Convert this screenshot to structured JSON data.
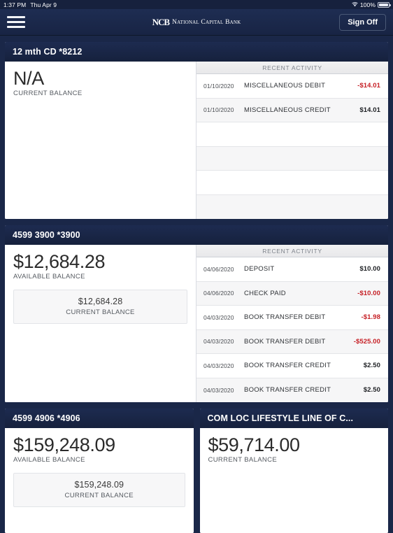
{
  "status_bar": {
    "time": "1:37 PM",
    "date": "Thu Apr 9",
    "wifi_icon": "wifi-icon",
    "battery_percent": "100%"
  },
  "navbar": {
    "menu_icon": "hamburger-menu-icon",
    "brand_mark": "NCB",
    "brand_name": "National Capital Bank",
    "sign_off_label": "Sign Off"
  },
  "activity_header": "RECENT ACTIVITY",
  "accounts": [
    {
      "title": "12 mth CD *8212",
      "balance": "N/A",
      "balance_label": "CURRENT BALANCE",
      "has_sub_balance": false,
      "activity": [
        {
          "date": "01/10/2020",
          "description": "MISCELLANEOUS DEBIT",
          "amount": "-$14.01",
          "negative": true
        },
        {
          "date": "01/10/2020",
          "description": "MISCELLANEOUS CREDIT",
          "amount": "$14.01",
          "negative": false
        },
        {
          "date": "",
          "description": "",
          "amount": "",
          "negative": false
        },
        {
          "date": "",
          "description": "",
          "amount": "",
          "negative": false
        },
        {
          "date": "",
          "description": "",
          "amount": "",
          "negative": false
        },
        {
          "date": "",
          "description": "",
          "amount": "",
          "negative": false
        }
      ]
    },
    {
      "title": "4599 3900 *3900",
      "balance": "$12,684.28",
      "balance_label": "AVAILABLE BALANCE",
      "has_sub_balance": true,
      "sub_balance": "$12,684.28",
      "sub_balance_label": "CURRENT BALANCE",
      "activity": [
        {
          "date": "04/06/2020",
          "description": "DEPOSIT",
          "amount": "$10.00",
          "negative": false
        },
        {
          "date": "04/06/2020",
          "description": "CHECK PAID",
          "amount": "-$10.00",
          "negative": true
        },
        {
          "date": "04/03/2020",
          "description": "BOOK TRANSFER DEBIT",
          "amount": "-$1.98",
          "negative": true
        },
        {
          "date": "04/03/2020",
          "description": "BOOK TRANSFER DEBIT",
          "amount": "-$525.00",
          "negative": true
        },
        {
          "date": "04/03/2020",
          "description": "BOOK TRANSFER CREDIT",
          "amount": "$2.50",
          "negative": false
        },
        {
          "date": "04/03/2020",
          "description": "BOOK TRANSFER CREDIT",
          "amount": "$2.50",
          "negative": false
        }
      ]
    },
    {
      "title": "4599 4906 *4906",
      "balance": "$159,248.09",
      "balance_label": "AVAILABLE BALANCE",
      "has_sub_balance": true,
      "sub_balance": "$159,248.09",
      "sub_balance_label": "CURRENT BALANCE"
    },
    {
      "title": "COM LOC LIFESTYLE LINE OF C...",
      "balance": "$59,714.00",
      "balance_label": "CURRENT BALANCE",
      "has_sub_balance": false
    }
  ],
  "colors": {
    "app_background": "#1a2748",
    "card_header": "#16213d",
    "negative_amount": "#c62026",
    "card_surface": "#ffffff"
  }
}
